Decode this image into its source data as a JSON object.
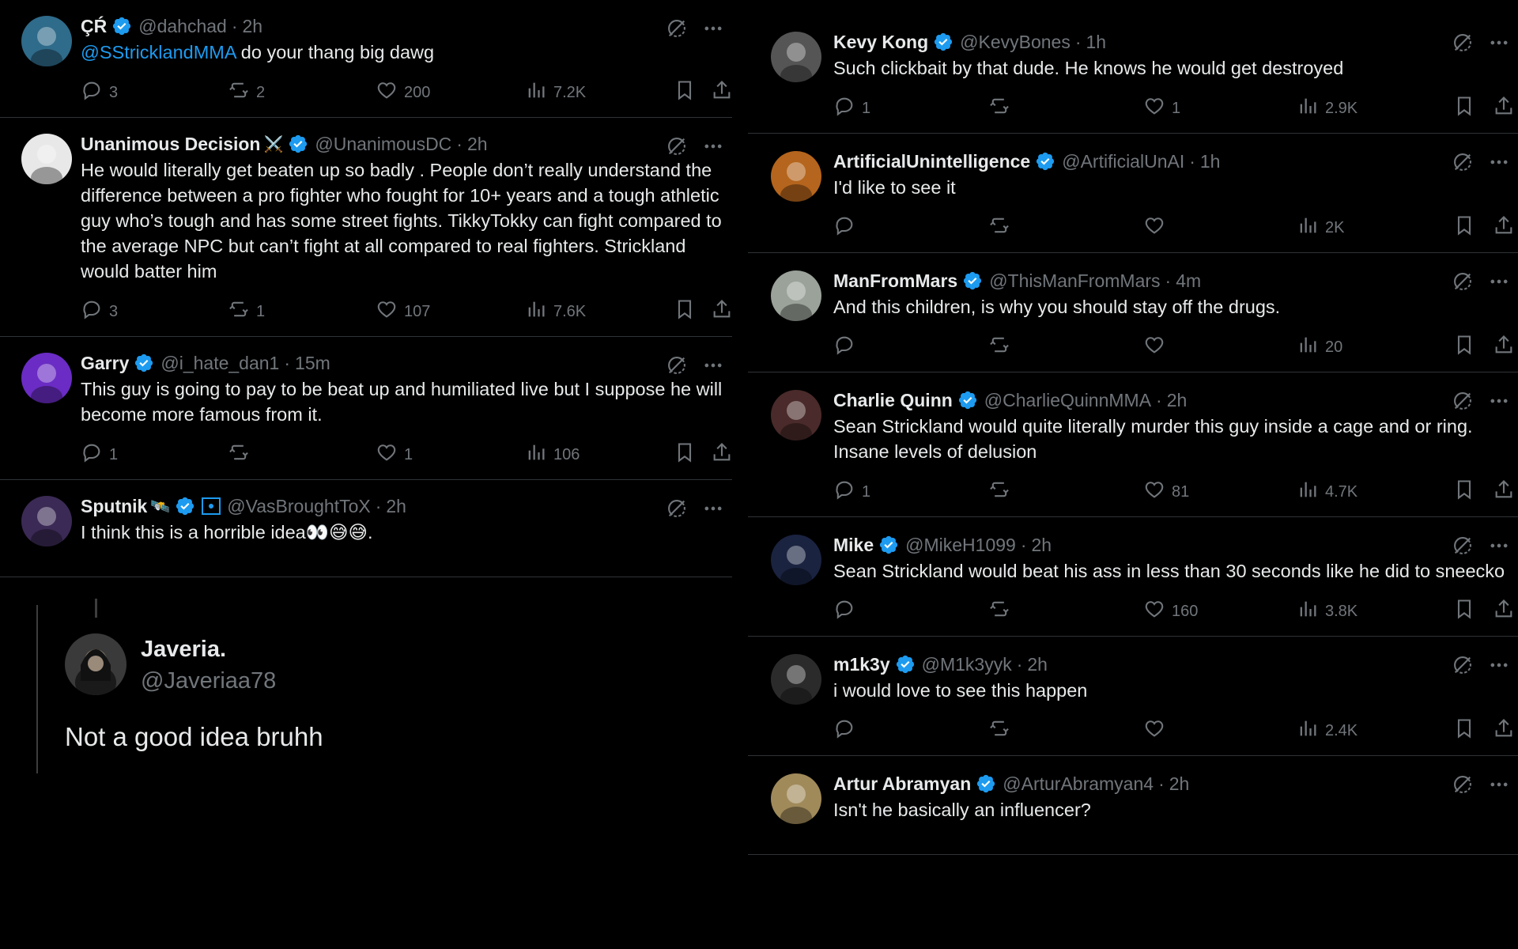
{
  "left_tweets": [
    {
      "name": "ÇŔ",
      "handle": "@dahchad",
      "time": "2h",
      "mention": "@SStricklandMMA",
      "text": " do your thang big dawg",
      "replies": "3",
      "retweets": "2",
      "likes": "200",
      "views": "7.2K",
      "avatar_color": "#2f6b8a"
    },
    {
      "name": "Unanimous Decision",
      "emoji": "⚔️",
      "handle": "@UnanimousDC",
      "time": "2h",
      "text": "He would literally get beaten up so badly . People don’t really understand the difference between a pro fighter who fought for 10+ years and a tough athletic guy who’s tough and has some street fights. TikkyTokky can fight compared to the average NPC but can’t fight at all compared to real fighters. Strickland would batter him",
      "replies": "3",
      "retweets": "1",
      "likes": "107",
      "views": "7.6K",
      "avatar_color": "#e8e8e8"
    },
    {
      "name": "Garry",
      "handle": "@i_hate_dan1",
      "time": "15m",
      "text": "This guy is going to pay to be beat up and humiliated live but I suppose he will become more famous from it.",
      "replies": "1",
      "retweets": "",
      "likes": "1",
      "views": "106",
      "avatar_color": "#6a2cc4"
    },
    {
      "name": "Sputnik",
      "emoji": "🛰️",
      "handle": "@VasBroughtToX",
      "time": "2h",
      "text": "I think this is a horrible idea👀😅😅.",
      "avatar_color": "#3b2a55"
    }
  ],
  "quote": {
    "name": "Javeria.",
    "handle": "@Javeriaa78",
    "text": "Not a good idea bruhh",
    "avatar_color": "#3a3a3a"
  },
  "right_tweets": [
    {
      "name": "Kevy Kong",
      "handle": "@KevyBones",
      "time": "1h",
      "text": "Such clickbait by that dude. He knows he would get destroyed",
      "replies": "1",
      "retweets": "",
      "likes": "1",
      "views": "2.9K",
      "avatar_color": "#555555"
    },
    {
      "name": "ArtificialUnintelligence",
      "handle": "@ArtificialUnAI",
      "time": "1h",
      "text": "I'd like to see it",
      "replies": "",
      "retweets": "",
      "likes": "",
      "views": "2K",
      "avatar_color": "#b5651d"
    },
    {
      "name": "ManFromMars",
      "handle": "@ThisManFromMars",
      "time": "4m",
      "text": "And this children,  is why you should stay off the drugs.",
      "replies": "",
      "retweets": "",
      "likes": "",
      "views": "20",
      "avatar_color": "#9aa29a"
    },
    {
      "name": "Charlie Quinn",
      "handle": "@CharlieQuinnMMA",
      "time": "2h",
      "text": "Sean Strickland would quite literally murder this guy inside a cage and or ring. Insane levels of delusion",
      "replies": "1",
      "retweets": "",
      "likes": "81",
      "views": "4.7K",
      "avatar_color": "#4a2a2a"
    },
    {
      "name": "Mike",
      "handle": "@MikeH1099",
      "time": "2h",
      "text": "Sean Strickland would beat his ass in less than 30 seconds like he did to sneecko",
      "replies": "",
      "retweets": "",
      "likes": "160",
      "views": "3.8K",
      "avatar_color": "#1a2340"
    },
    {
      "name": "m1k3y",
      "handle": "@M1k3yyk",
      "time": "2h",
      "text": "i would love to see this happen",
      "replies": "",
      "retweets": "",
      "likes": "",
      "views": "2.4K",
      "avatar_color": "#2b2b2b"
    },
    {
      "name": "Artur Abramyan",
      "handle": "@ArturAbramyan4",
      "time": "2h",
      "text": "Isn't he basically an influencer?",
      "avatar_color": "#a08a5a"
    }
  ],
  "colors": {
    "background": "#000000",
    "text_primary": "#e7e9ea",
    "text_secondary": "#71767b",
    "accent": "#1d9bf0",
    "divider": "#2f3336"
  },
  "icons": [
    "verified-badge-icon",
    "grok-icon",
    "more-icon",
    "reply-icon",
    "retweet-icon",
    "like-icon",
    "views-icon",
    "bookmark-icon",
    "share-icon"
  ]
}
